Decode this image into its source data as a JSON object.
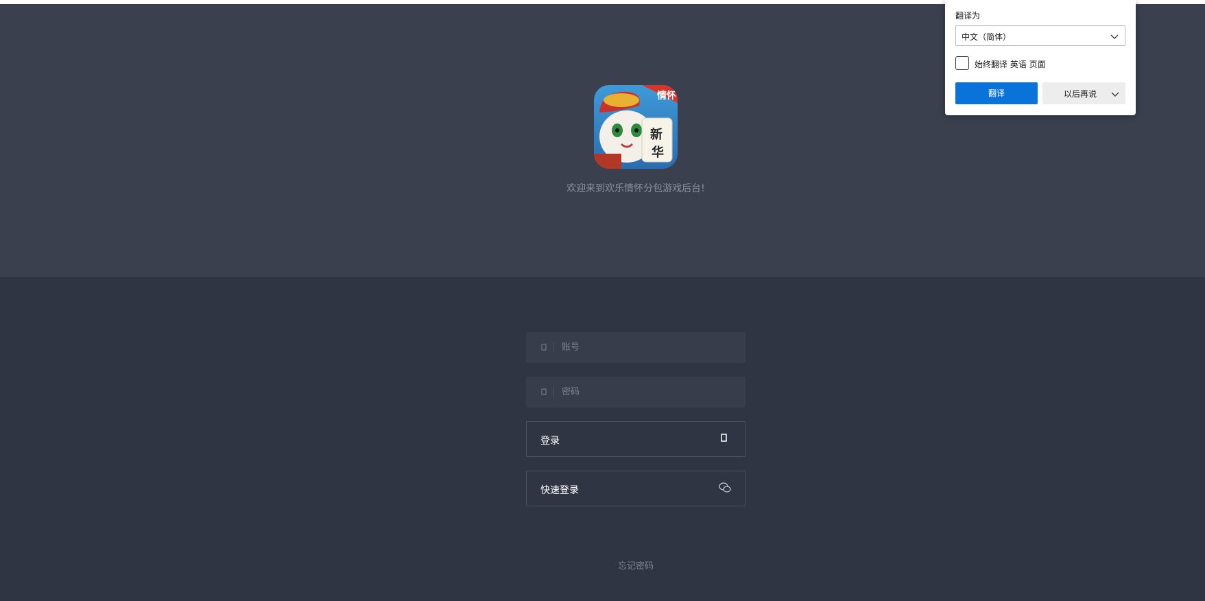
{
  "header": {
    "welcome": "欢迎来到欢乐情怀分包游戏后台!",
    "logo_badge": "情怀",
    "logo_tile_text": [
      "新",
      "华"
    ]
  },
  "login": {
    "account_placeholder": "账号",
    "password_placeholder": "密码",
    "login_label": "登录",
    "quick_login_label": "快速登录",
    "forgot_password": "忘记密码"
  },
  "translate_popup": {
    "title": "翻译为",
    "language": "中文（简体）",
    "always_translate": "始终翻译 英语 页面",
    "translate_button": "翻译",
    "later_button": "以后再说"
  },
  "colors": {
    "hero_bg": "#3a404e",
    "page_bg": "#2f3542",
    "accent_blue": "#0a73d9"
  },
  "icons": {
    "account_field": "user-icon",
    "password_field": "lock-icon",
    "login_button": "square-icon",
    "quick_login_button": "wechat-icon"
  }
}
